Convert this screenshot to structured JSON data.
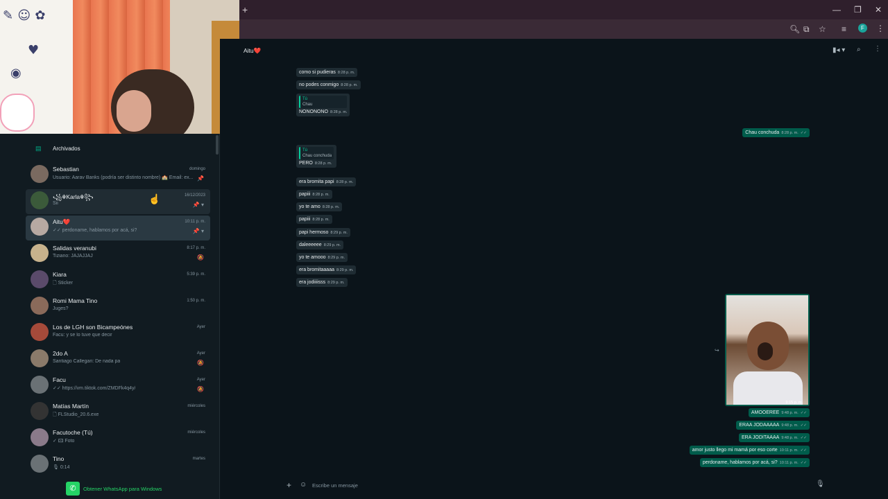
{
  "browser": {
    "new_tab": "+",
    "win_min": "—",
    "win_max": "❐",
    "win_close": "✕",
    "avatar_letter": "F"
  },
  "sidebar": {
    "archived_label": "Archivados",
    "chats": [
      {
        "name": "Sebastian",
        "preview": "Usuario: Aarav Banks (podría ser distinto nombre) 🏫 Email: ex...",
        "time": "domingo"
      },
      {
        "name": "꧁☬Karla☬꧂",
        "preview": "Sii",
        "time": "16/12/2023"
      },
      {
        "name": "Aitu❤️",
        "preview": "✓✓ perdoname, hablamos por acá, si?",
        "time": "10:11 p. m."
      },
      {
        "name": "Salidas veranubi",
        "preview": "Tiziano: JAJAJJAJ",
        "time": "8:17 p. m."
      },
      {
        "name": "Kiara",
        "preview": "🗋 Sticker",
        "time": "5:39 p. m."
      },
      {
        "name": "Romi Mama Tino",
        "preview": "Juges?",
        "time": "1:50 p. m."
      },
      {
        "name": "Los de LGH son Bicampeónes",
        "preview": "Facu: y se lo tuve que decir",
        "time": "Ayer"
      },
      {
        "name": "2do A",
        "preview": "Santiago Callegari: De nada pa",
        "time": "Ayer"
      },
      {
        "name": "Facu",
        "preview": "✓✓ https://vm.tiktok.com/ZMDFk4q4y/",
        "time": "Ayer"
      },
      {
        "name": "Matías Martín",
        "preview": "🗋 FLStudio_20.6.exe",
        "time": "miércoles"
      },
      {
        "name": "Facutoche (Tú)",
        "preview": "✓ 🖾 Foto",
        "time": "miércoles"
      },
      {
        "name": "Tino",
        "preview": "🎙 0:14",
        "time": "martes"
      }
    ],
    "get_windows": "Obtener WhatsApp para Windows"
  },
  "chat": {
    "title": "Aitu❤️",
    "incoming": [
      {
        "text": "como si pudieras",
        "time": "8:28 p. m."
      },
      {
        "text": "no podes conmigo",
        "time": "8:28 p. m."
      },
      {
        "quote_author": "Tú",
        "quote_text": "Chau",
        "text": "NONONONO",
        "time": "8:28 p. m."
      },
      {
        "quote_author": "Tú",
        "quote_text": "Chau conchuda",
        "text": "PERO",
        "time": "8:28 p. m."
      },
      {
        "text": "era bromita papi",
        "time": "8:28 p. m."
      },
      {
        "text": "papiii",
        "time": "8:28 p. m."
      },
      {
        "text": "yo te amo",
        "time": "8:28 p. m."
      },
      {
        "text": "papiii",
        "time": "8:28 p. m."
      },
      {
        "text": "papi hermoso",
        "time": "8:29 p. m."
      },
      {
        "text": "daleeeeee",
        "time": "8:29 p. m."
      },
      {
        "text": "yo te amooo",
        "time": "8:29 p. m."
      },
      {
        "text": "era bromitaaaaa",
        "time": "8:29 p. m."
      },
      {
        "text": "era jodiiiisss",
        "time": "8:29 p. m."
      }
    ],
    "outgoing_top": {
      "text": "Chau conchuda",
      "time": "8:28 p. m."
    },
    "image_time": "9:15 p. m.",
    "outgoing": [
      {
        "text": "AMOOEREE",
        "time": "9:48 p. m."
      },
      {
        "text": "ERAA JODAAAAA",
        "time": "9:48 p. m."
      },
      {
        "text": "ERA JODITAAAA",
        "time": "9:48 p. m."
      },
      {
        "text": "amor justo llego mi mamá por eso corte",
        "time": "10:11 p. m."
      },
      {
        "text": "perdoname, hablamos por acá, si?",
        "time": "10:11 p. m."
      }
    ],
    "composer_placeholder": "Escribe un mensaje"
  },
  "colors": {
    "accent": "#00a884",
    "bubble_out": "#005c4b",
    "bubble_in": "#1f2c33"
  }
}
